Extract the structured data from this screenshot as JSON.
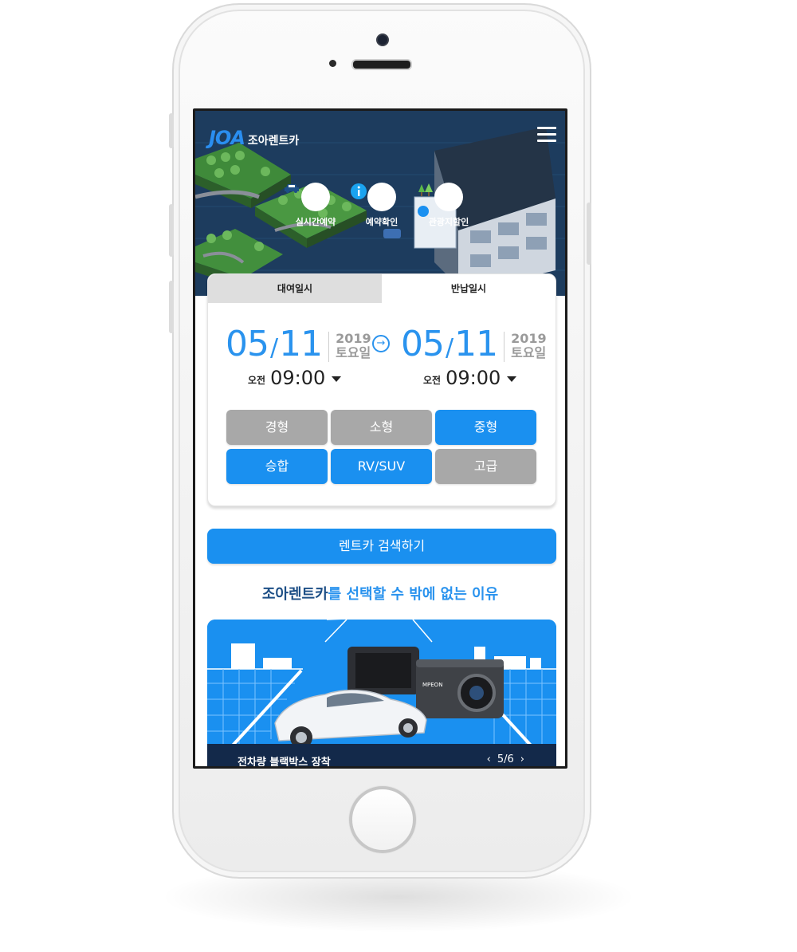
{
  "header": {
    "logo_mark": "JOA",
    "logo_text": "조아렌트카",
    "menu_icon": "hamburger-menu-icon"
  },
  "quick_links": [
    {
      "label": "실시간예약",
      "icon": "car-icon"
    },
    {
      "label": "예약확인",
      "icon": "info-icon"
    },
    {
      "label": "관광지할인",
      "icon": "trees-icon"
    }
  ],
  "booking": {
    "tabs": [
      {
        "label": "대여일시",
        "active": false
      },
      {
        "label": "반납일시",
        "active": true
      }
    ],
    "pickup": {
      "month": "05",
      "day": "11",
      "year": "2019",
      "weekday": "토요일",
      "ampm": "오전",
      "time": "09:00"
    },
    "return": {
      "month": "05",
      "day": "11",
      "year": "2019",
      "weekday": "토요일",
      "ampm": "오전",
      "time": "09:00"
    },
    "categories": [
      {
        "label": "경형",
        "selected": false
      },
      {
        "label": "소형",
        "selected": false
      },
      {
        "label": "중형",
        "selected": true
      },
      {
        "label": "승합",
        "selected": true
      },
      {
        "label": "RV/SUV",
        "selected": true
      },
      {
        "label": "고급",
        "selected": false
      }
    ]
  },
  "search_button": "렌트카 검색하기",
  "reason_title": {
    "brand": "조아렌트카",
    "rest": "를 선택할 수 밖에 없는 이유"
  },
  "banner": {
    "dashcam_brand": "MPEON",
    "caption": "전차량 블랙박스 장착",
    "page": "5/6",
    "prev_icon": "chevron-left-icon",
    "next_icon": "chevron-right-icon"
  },
  "colors": {
    "accent": "#1a90f0",
    "inactive": "#a8a8a8",
    "navy": "#13294a"
  }
}
